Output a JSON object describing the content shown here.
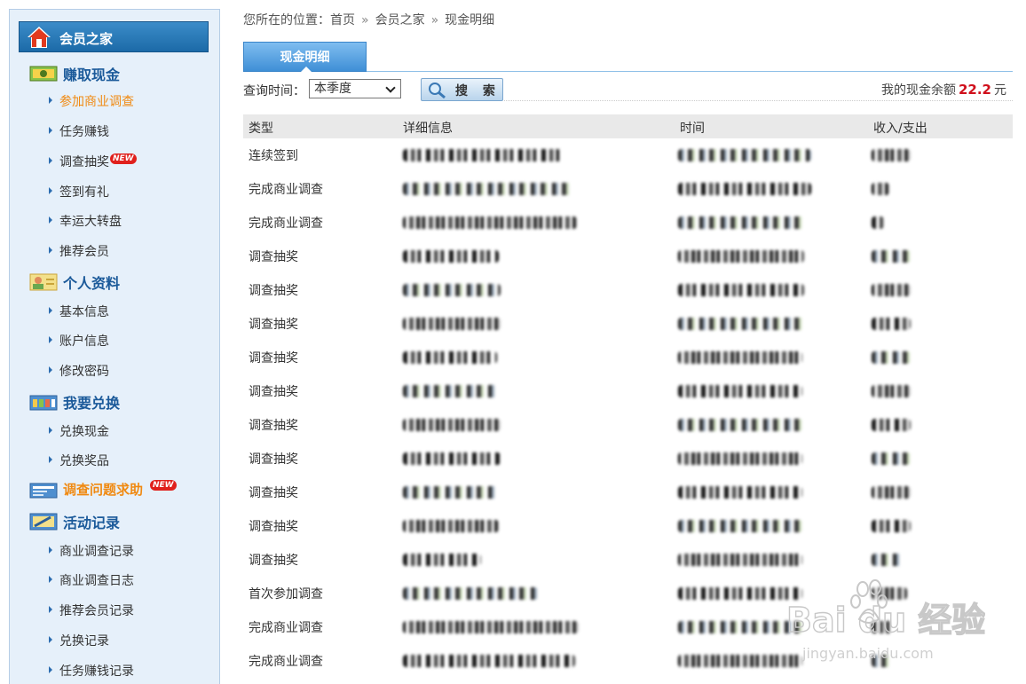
{
  "sidebar": {
    "home_label": "会员之家",
    "sections": [
      {
        "label": "赚取现金",
        "icon": "money-icon",
        "items": [
          {
            "label": "参加商业调查",
            "active": true
          },
          {
            "label": "任务赚钱"
          },
          {
            "label": "调查抽奖",
            "badge": "NEW"
          },
          {
            "label": "签到有礼"
          },
          {
            "label": "幸运大转盘"
          },
          {
            "label": "推荐会员"
          }
        ]
      },
      {
        "label": "个人资料",
        "icon": "profile-icon",
        "items": [
          {
            "label": "基本信息"
          },
          {
            "label": "账户信息"
          },
          {
            "label": "修改密码"
          }
        ]
      },
      {
        "label": "我要兑换",
        "icon": "basket-icon",
        "items": [
          {
            "label": "兑换现金"
          },
          {
            "label": "兑换奖品"
          }
        ]
      },
      {
        "label": "调查问题求助",
        "icon": "help-card-icon",
        "badge": "NEW"
      },
      {
        "label": "活动记录",
        "icon": "record-icon",
        "items": [
          {
            "label": "商业调查记录"
          },
          {
            "label": "商业调查日志"
          },
          {
            "label": "推荐会员记录"
          },
          {
            "label": "兑换记录"
          },
          {
            "label": "任务赚钱记录"
          }
        ]
      }
    ]
  },
  "breadcrumb": {
    "prefix": "您所在的位置：",
    "items": [
      "首页",
      "会员之家",
      "现金明细"
    ],
    "separator": "»"
  },
  "tab": {
    "label": "现金明细"
  },
  "query": {
    "label": "查询时间：",
    "selected": "本季度",
    "search_label": "搜 索"
  },
  "balance": {
    "prefix": "我的现金余额",
    "amount": "22.2",
    "unit": "元"
  },
  "table": {
    "headers": [
      "类型",
      "详细信息",
      "时间",
      "收入/支出"
    ],
    "rows": [
      {
        "type": "连续签到"
      },
      {
        "type": "完成商业调查"
      },
      {
        "type": "完成商业调查"
      },
      {
        "type": "调查抽奖"
      },
      {
        "type": "调查抽奖"
      },
      {
        "type": "调查抽奖"
      },
      {
        "type": "调查抽奖"
      },
      {
        "type": "调查抽奖"
      },
      {
        "type": "调查抽奖"
      },
      {
        "type": "调查抽奖"
      },
      {
        "type": "调查抽奖"
      },
      {
        "type": "调查抽奖"
      },
      {
        "type": "调查抽奖"
      },
      {
        "type": "首次参加调查"
      },
      {
        "type": "完成商业调查"
      },
      {
        "type": "完成商业调查"
      }
    ]
  },
  "watermark": {
    "text": "Bai du 经验",
    "url_text": "jingyan.baidu.com"
  },
  "colors": {
    "accent_blue": "#1b5a9a",
    "orange": "#f08a12",
    "amount_red": "#d0101c"
  }
}
